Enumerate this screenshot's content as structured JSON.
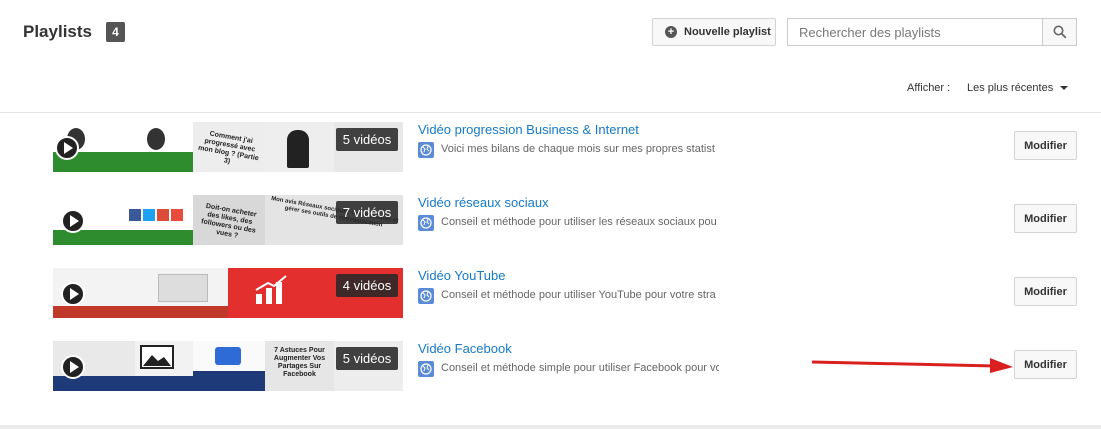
{
  "header": {
    "title": "Playlists",
    "count": "4",
    "new_playlist_label": "Nouvelle playlist",
    "search_placeholder": "Rechercher des playlists",
    "sort_label": "Afficher :",
    "sort_value": "Les plus récentes"
  },
  "playlists": [
    {
      "title": "Vidéo progression Business & Internet",
      "description": "Voici mes bilans de chaque mois sur mes propres statist",
      "video_count": "5 vidéos",
      "edit_label": "Modifier",
      "thumb_texts": [
        "Comment j'ai progressé avec mon blog ? (Partie 3)"
      ]
    },
    {
      "title": "Vidéo réseaux sociaux",
      "description": "Conseil et méthode pour utiliser les réseaux sociaux pou",
      "video_count": "7 vidéos",
      "edit_label": "Modifier",
      "thumb_texts": [
        "Doit-on acheter des likes, des followers ou des vues ?",
        "Mon avis Réseaux sociaux : Communiquer et gérer ses outils de communication"
      ]
    },
    {
      "title": "Vidéo YouTube",
      "description": "Conseil et méthode pour utiliser YouTube pour votre stra",
      "video_count": "4 vidéos",
      "edit_label": "Modifier",
      "thumb_texts": []
    },
    {
      "title": "Vidéo Facebook",
      "description": "Conseil et méthode simple pour utiliser Facebook pour vo",
      "video_count": "5 vidéos",
      "edit_label": "Modifier",
      "thumb_texts": [
        "7 Astuces Pour Augmenter Vos Partages Sur Facebook"
      ]
    }
  ],
  "colors": {
    "link": "#167ac6",
    "annotation_arrow": "#d9201f"
  }
}
